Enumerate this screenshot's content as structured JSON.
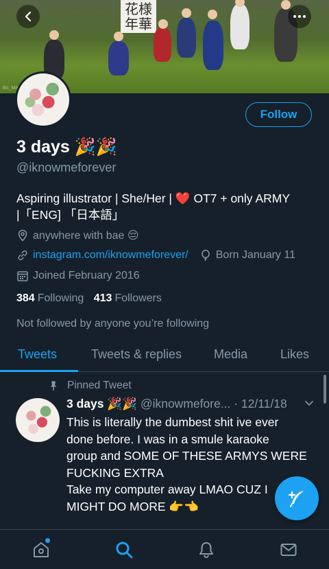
{
  "banner": {
    "sign_text": "花様年華",
    "credit": "Bo_Map"
  },
  "profile": {
    "display_name": "3 days 🎉🎉",
    "handle": "@iknowmeforever",
    "follow_label": "Follow",
    "bio_line1": "Aspiring illustrator | She/Her | ❤️  OT7 + only ARMY",
    "bio_line2": "|「ENG] 「日本語」",
    "location": "anywhere with bae 😔",
    "website": "instagram.com/iknowmeforever/",
    "birthday": "Born January 11",
    "joined": "Joined February 2016",
    "following_count": "384",
    "following_label": "Following",
    "followers_count": "413",
    "followers_label": "Followers",
    "not_followed": "Not followed by anyone you’re following"
  },
  "tabs": [
    "Tweets",
    "Tweets & replies",
    "Media",
    "Likes"
  ],
  "active_tab": "Tweets",
  "tweet": {
    "pinned_label": "Pinned Tweet",
    "name": "3 days 🎉🎉",
    "meta": "@iknowmefore... · 12/11/18",
    "text_lines": [
      "This is literally the dumbest shit ive ever",
      "done before. I was in a smule karaoke",
      "group and SOME OF THESE ARMYS WERE",
      "FUCKING EXTRA",
      "Take my computer away LMAO CUZ I",
      "MIGHT DO MORE 👉👈"
    ]
  },
  "icons": {
    "back": "back-arrow-icon",
    "more": "more-dots-icon",
    "location": "location-pin-icon",
    "link": "link-icon",
    "birthday": "balloon-icon",
    "calendar": "calendar-icon",
    "pin": "pin-icon",
    "chevron": "chevron-down-icon",
    "compose": "compose-icon",
    "home": "home-icon",
    "search": "search-icon",
    "notifications": "bell-icon",
    "messages": "mail-icon"
  },
  "colors": {
    "accent": "#1da1f2",
    "background": "#15202b",
    "muted": "#8899a6"
  }
}
